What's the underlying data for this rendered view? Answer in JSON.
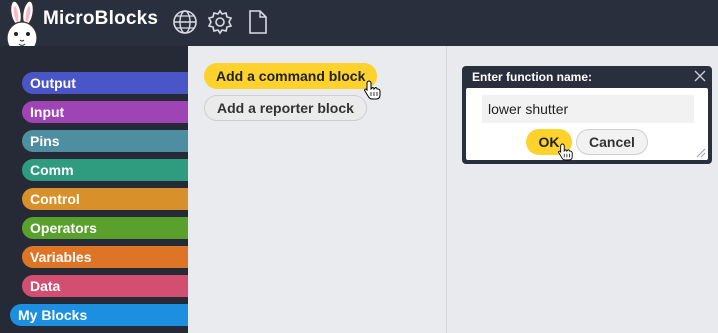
{
  "app": {
    "title": "MicroBlocks",
    "icons": [
      "bunny-logo-icon",
      "globe-icon",
      "gear-icon",
      "file-icon"
    ]
  },
  "sidebar": {
    "categories": [
      {
        "label": "Output",
        "color": "#4a56c8"
      },
      {
        "label": "Input",
        "color": "#a043b4"
      },
      {
        "label": "Pins",
        "color": "#4d8fa0"
      },
      {
        "label": "Comm",
        "color": "#2f9c80"
      },
      {
        "label": "Control",
        "color": "#d8912a"
      },
      {
        "label": "Operators",
        "color": "#5aa02c"
      },
      {
        "label": "Variables",
        "color": "#de7426"
      },
      {
        "label": "Data",
        "color": "#d24f72"
      },
      {
        "label": "My Blocks",
        "color": "#1d8fe0",
        "selected": true
      }
    ]
  },
  "palette": {
    "add_command_label": "Add a command block",
    "add_reporter_label": "Add a reporter block",
    "command_color": "#fdd22c"
  },
  "dialog": {
    "title": "Enter function name:",
    "input_value": "lower shutter",
    "ok_label": "OK",
    "cancel_label": "Cancel",
    "close_icon": "close-icon",
    "resize_icon": "resize-grip-icon"
  }
}
